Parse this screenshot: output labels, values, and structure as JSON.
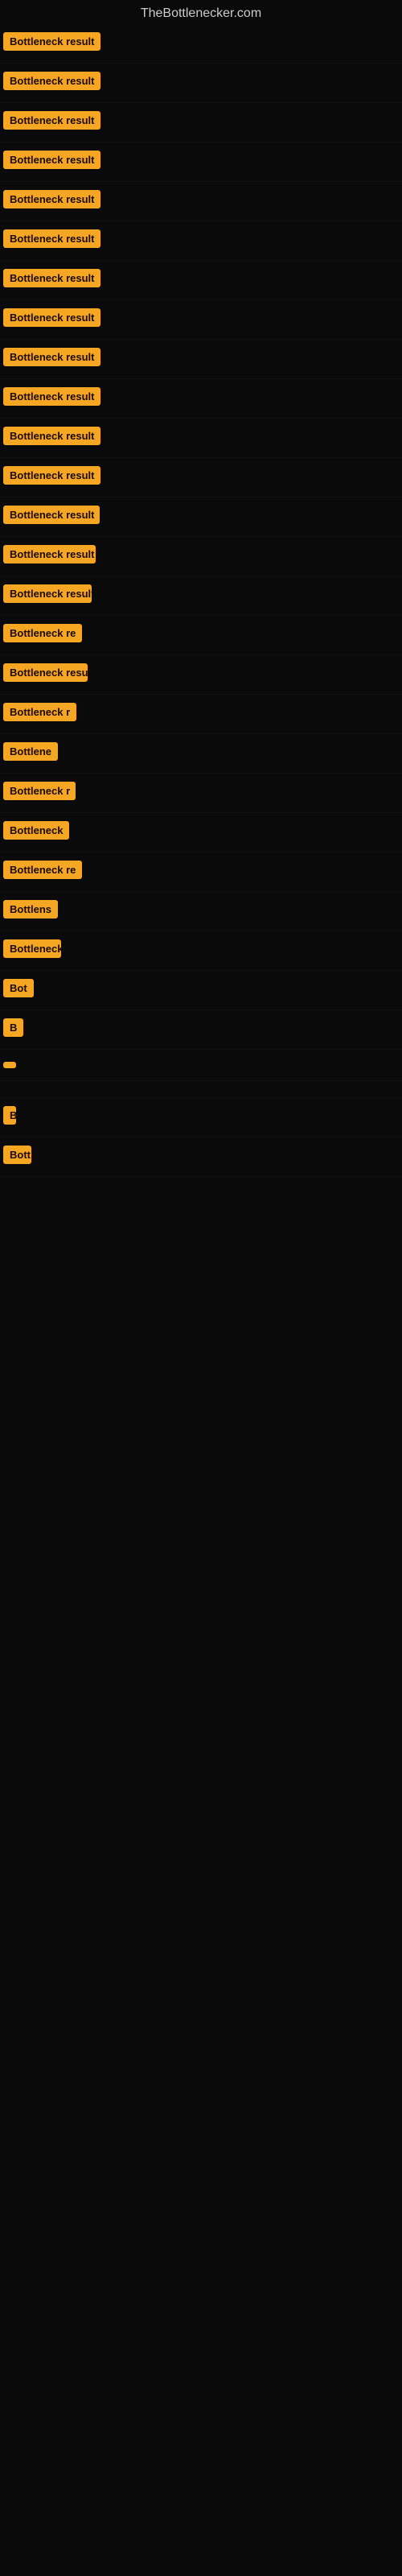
{
  "site": {
    "title": "TheBottlenecker.com"
  },
  "rows": [
    {
      "id": 1,
      "label": "Bottleneck result"
    },
    {
      "id": 2,
      "label": "Bottleneck result"
    },
    {
      "id": 3,
      "label": "Bottleneck result"
    },
    {
      "id": 4,
      "label": "Bottleneck result"
    },
    {
      "id": 5,
      "label": "Bottleneck result"
    },
    {
      "id": 6,
      "label": "Bottleneck result"
    },
    {
      "id": 7,
      "label": "Bottleneck result"
    },
    {
      "id": 8,
      "label": "Bottleneck result"
    },
    {
      "id": 9,
      "label": "Bottleneck result"
    },
    {
      "id": 10,
      "label": "Bottleneck result"
    },
    {
      "id": 11,
      "label": "Bottleneck result"
    },
    {
      "id": 12,
      "label": "Bottleneck result"
    },
    {
      "id": 13,
      "label": "Bottleneck result"
    },
    {
      "id": 14,
      "label": "Bottleneck result"
    },
    {
      "id": 15,
      "label": "Bottleneck result"
    },
    {
      "id": 16,
      "label": "Bottleneck re"
    },
    {
      "id": 17,
      "label": "Bottleneck result"
    },
    {
      "id": 18,
      "label": "Bottleneck r"
    },
    {
      "id": 19,
      "label": "Bottlene"
    },
    {
      "id": 20,
      "label": "Bottleneck r"
    },
    {
      "id": 21,
      "label": "Bottleneck"
    },
    {
      "id": 22,
      "label": "Bottleneck re"
    },
    {
      "id": 23,
      "label": "Bottlens"
    },
    {
      "id": 24,
      "label": "Bottleneck"
    },
    {
      "id": 25,
      "label": "Bot"
    },
    {
      "id": 26,
      "label": "B"
    },
    {
      "id": 27,
      "label": ""
    },
    {
      "id": 28,
      "label": ""
    },
    {
      "id": 29,
      "label": "B"
    },
    {
      "id": 30,
      "label": "Bott"
    }
  ]
}
